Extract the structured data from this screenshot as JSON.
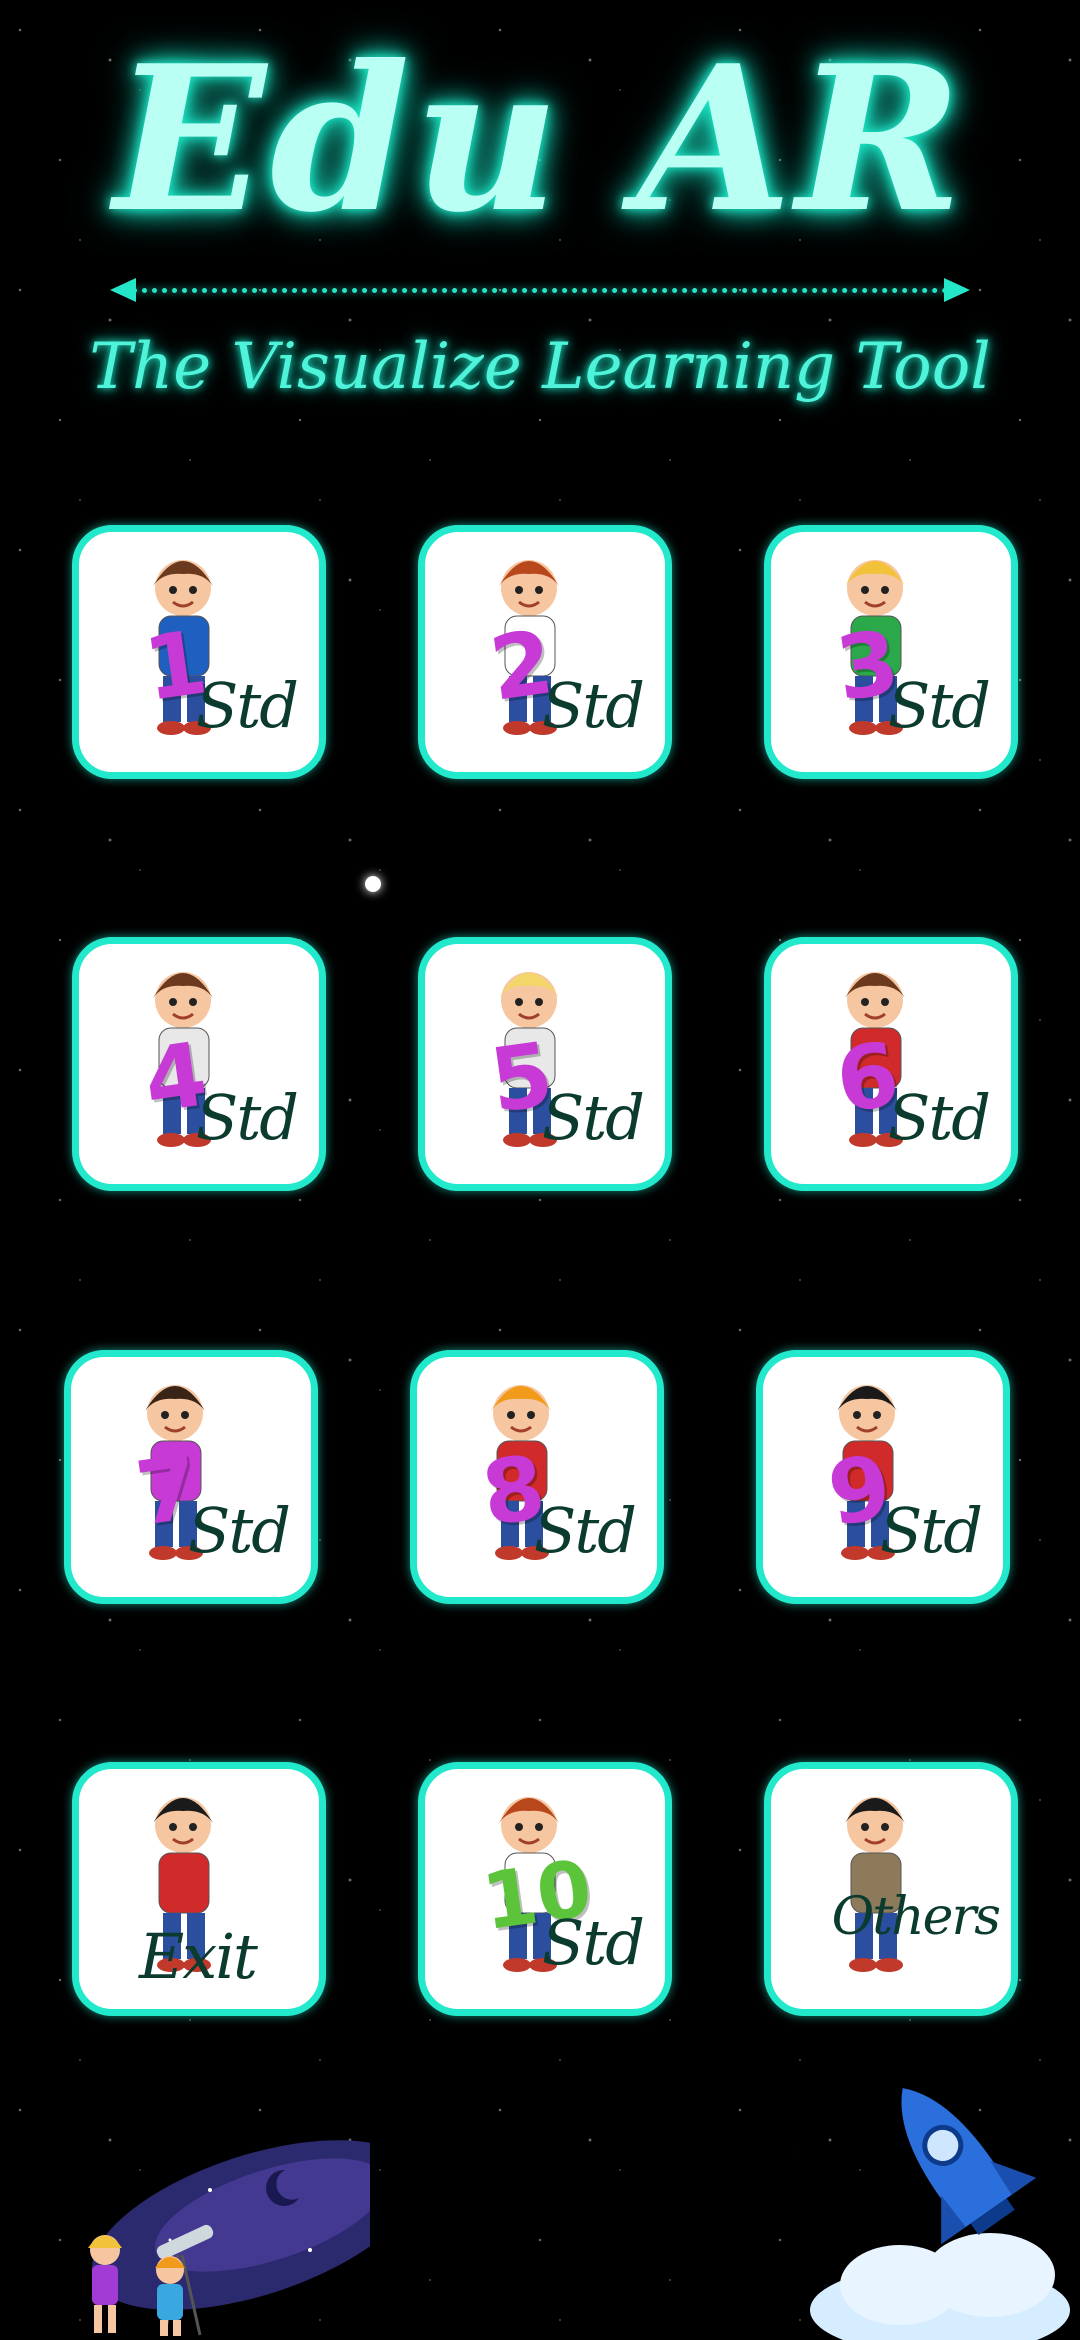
{
  "header": {
    "title": "Edu AR",
    "subtitle": "The Visualize Learning Tool"
  },
  "tiles": [
    {
      "number": "1",
      "label": "Std",
      "shirt": "#1f5fbf",
      "hair": "#6b3a1e",
      "numColor": "#c73ad6"
    },
    {
      "number": "2",
      "label": "Std",
      "shirt": "#ffffff",
      "hair": "#b8481c",
      "numColor": "#c73ad6"
    },
    {
      "number": "3",
      "label": "Std",
      "shirt": "#2aa84a",
      "hair": "#f2c23a",
      "numColor": "#c73ad6"
    },
    {
      "number": "4",
      "label": "Std",
      "shirt": "#e8e8e8",
      "hair": "#6b3a1e",
      "numColor": "#c73ad6"
    },
    {
      "number": "5",
      "label": "Std",
      "shirt": "#e8e8e8",
      "hair": "#f2d66a",
      "numColor": "#c73ad6"
    },
    {
      "number": "6",
      "label": "Std",
      "shirt": "#d12a2a",
      "hair": "#6b3a1e",
      "numColor": "#c73ad6"
    },
    {
      "number": "7",
      "label": "Std",
      "shirt": "#c73ad6",
      "hair": "#3a2418",
      "numColor": "#c73ad6"
    },
    {
      "number": "8",
      "label": "Std",
      "shirt": "#d12a2a",
      "hair": "#f29a1a",
      "numColor": "#c73ad6"
    },
    {
      "number": "9",
      "label": "Std",
      "shirt": "#d12a2a",
      "hair": "#1a1a1a",
      "numColor": "#c73ad6"
    },
    {
      "number": "",
      "label": "Exit",
      "shirt": "#d12a2a",
      "hair": "#1a1a1a",
      "numColor": "#c73ad6"
    },
    {
      "number": "10",
      "label": "Std",
      "shirt": "#ffffff",
      "hair": "#b8481c",
      "numColor": "#5cc43a"
    },
    {
      "number": "",
      "label": "Others",
      "shirt": "#8c7a5a",
      "hair": "#1a1a1a",
      "numColor": "#c73ad6"
    }
  ],
  "colors": {
    "accent": "#22e8cc",
    "title_glow": "#1de9c8",
    "background": "#000000"
  },
  "decorations": {
    "left": "kids-telescope-icon",
    "right": "rocket-icon"
  }
}
